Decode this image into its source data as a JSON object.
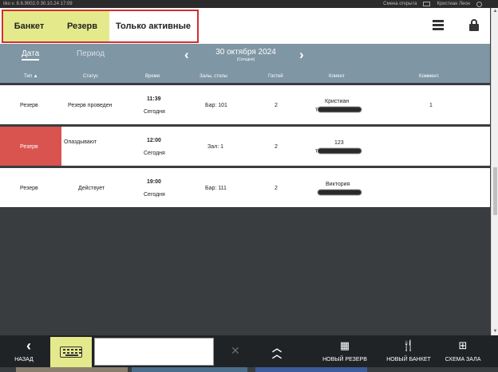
{
  "system_bar": {
    "left": "iiko  v. 8.6.9002.0     30.10.24     17:09",
    "shift": "Смена открыта",
    "user": "Кристиан Леон"
  },
  "tabs": [
    {
      "label": "Банкет"
    },
    {
      "label": "Резерв"
    },
    {
      "label": "Только активные"
    }
  ],
  "date_nav": {
    "date_tab": "Дата",
    "period_tab": "Период",
    "prev": "‹",
    "next": "›",
    "date": "30 октября 2024",
    "date_sub": "(Сегодня)"
  },
  "columns": {
    "type": "Тип ▲",
    "status": "Статус",
    "time": "Время",
    "halls": "Залы, столы",
    "guests": "Гостей",
    "client": "Клиент",
    "comment": "Коммент."
  },
  "rows": [
    {
      "type": "Резерв",
      "status": "Резерв проведен",
      "time": "11:39",
      "day": "Сегодня",
      "halls": "Бар: 101",
      "guests": "2",
      "client": "Кристиан",
      "phone_prefix": "т",
      "comment": "1"
    },
    {
      "type": "Резерв",
      "status": "Опаздывают",
      "time": "12:00",
      "day": "Сегодня",
      "halls": "Зал: 1",
      "guests": "2",
      "client": "123",
      "phone_prefix": "т",
      "comment": ""
    },
    {
      "type": "Резерв",
      "status": "Действует",
      "time": "19:00",
      "day": "Сегодня",
      "halls": "Бар: 111",
      "guests": "2",
      "client": "Виктория",
      "phone_prefix": "",
      "comment": ""
    }
  ],
  "bottom": {
    "back": "НАЗАД",
    "search_value": "",
    "new_reserve": "НОВЫЙ РЕЗЕРВ",
    "new_banquet": "НОВЫЙ БАНКЕТ",
    "hall_scheme": "СХЕМА ЗАЛА"
  },
  "colors": {
    "accent_tab": "#e4ea8c",
    "late_row": "#d9534f",
    "header_band": "#7f96a4",
    "highlight_border": "#d32f2f"
  }
}
